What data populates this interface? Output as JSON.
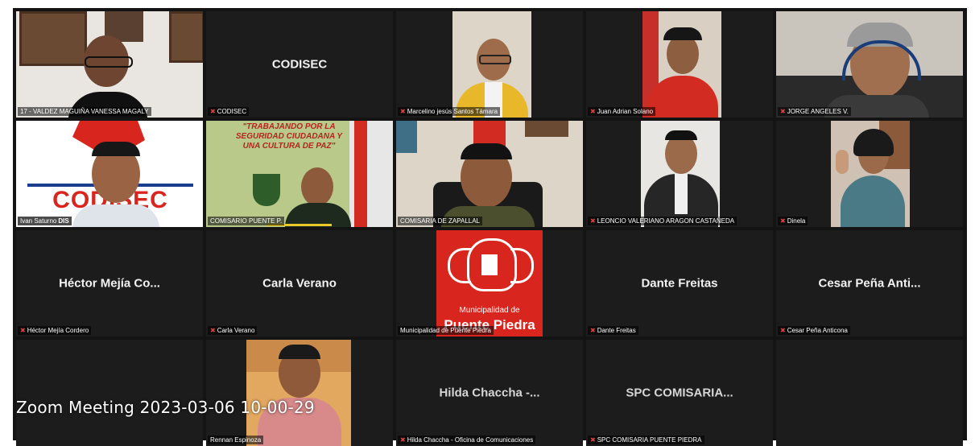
{
  "meeting_caption": "Zoom Meeting 2023-03-06 10-00-29",
  "participants": [
    {
      "tag": "17 - VALDEZ MAGUIÑA VANESSA MAGALY",
      "center": "",
      "type": "video",
      "speaker": true
    },
    {
      "tag": "CODISEC",
      "center": "CODISEC",
      "type": "name"
    },
    {
      "tag": "Marcelino jesús Santos Támara",
      "center": "",
      "type": "video"
    },
    {
      "tag": "Juan Adrian Solano",
      "center": "",
      "type": "video"
    },
    {
      "tag": "JORGE ANGELES V.",
      "center": "",
      "type": "video"
    },
    {
      "tag": "Ivan Saturno",
      "center": "",
      "type": "video",
      "banner": "CODISEC",
      "banner2": "DIS"
    },
    {
      "tag": "COMISARIO PUENTE P.",
      "center": "",
      "type": "video",
      "banner": "\"TRABAJANDO POR LA SEGURIDAD CIUDADANA Y UNA CULTURA DE PAZ\""
    },
    {
      "tag": "COMISARIA DE ZAPALLAL",
      "center": "",
      "type": "video"
    },
    {
      "tag": "LEONCIO VALERIANO ARAGON CASTAÑEDA",
      "center": "",
      "type": "video"
    },
    {
      "tag": "Dinela",
      "center": "",
      "type": "video"
    },
    {
      "tag": "Héctor Mejía Cordero",
      "center": "Héctor Mejía Co...",
      "type": "name"
    },
    {
      "tag": "Carla Verano",
      "center": "Carla Verano",
      "type": "name"
    },
    {
      "tag": "Municipalidad de Puente Piedra",
      "center": "",
      "type": "logo",
      "logo_text": "Municipalidad de",
      "logo_text2": "Puente Piedra"
    },
    {
      "tag": "Dante Freitas",
      "center": "Dante Freitas",
      "type": "name"
    },
    {
      "tag": "Cesar Peña Anticona",
      "center": "Cesar Peña Anti...",
      "type": "name"
    },
    {
      "tag": "",
      "center": "",
      "type": "empty"
    },
    {
      "tag": "Rennan Espinoza",
      "center": "",
      "type": "video"
    },
    {
      "tag": "Hilda Chaccha - Oficina de Comunicaciones",
      "center": "Hilda Chaccha -...",
      "type": "name"
    },
    {
      "tag": "SPC COMISARIA PUENTE PIEDRA",
      "center": "SPC COMISARIA...",
      "type": "name"
    },
    {
      "tag": "",
      "center": "",
      "type": "empty"
    }
  ],
  "colors": {
    "background": "#141414",
    "tile": "#1c1c1c",
    "speaker_outline": "#b8d86a",
    "mic_muted": "#e0403a",
    "municipal_red": "#d8261f"
  }
}
